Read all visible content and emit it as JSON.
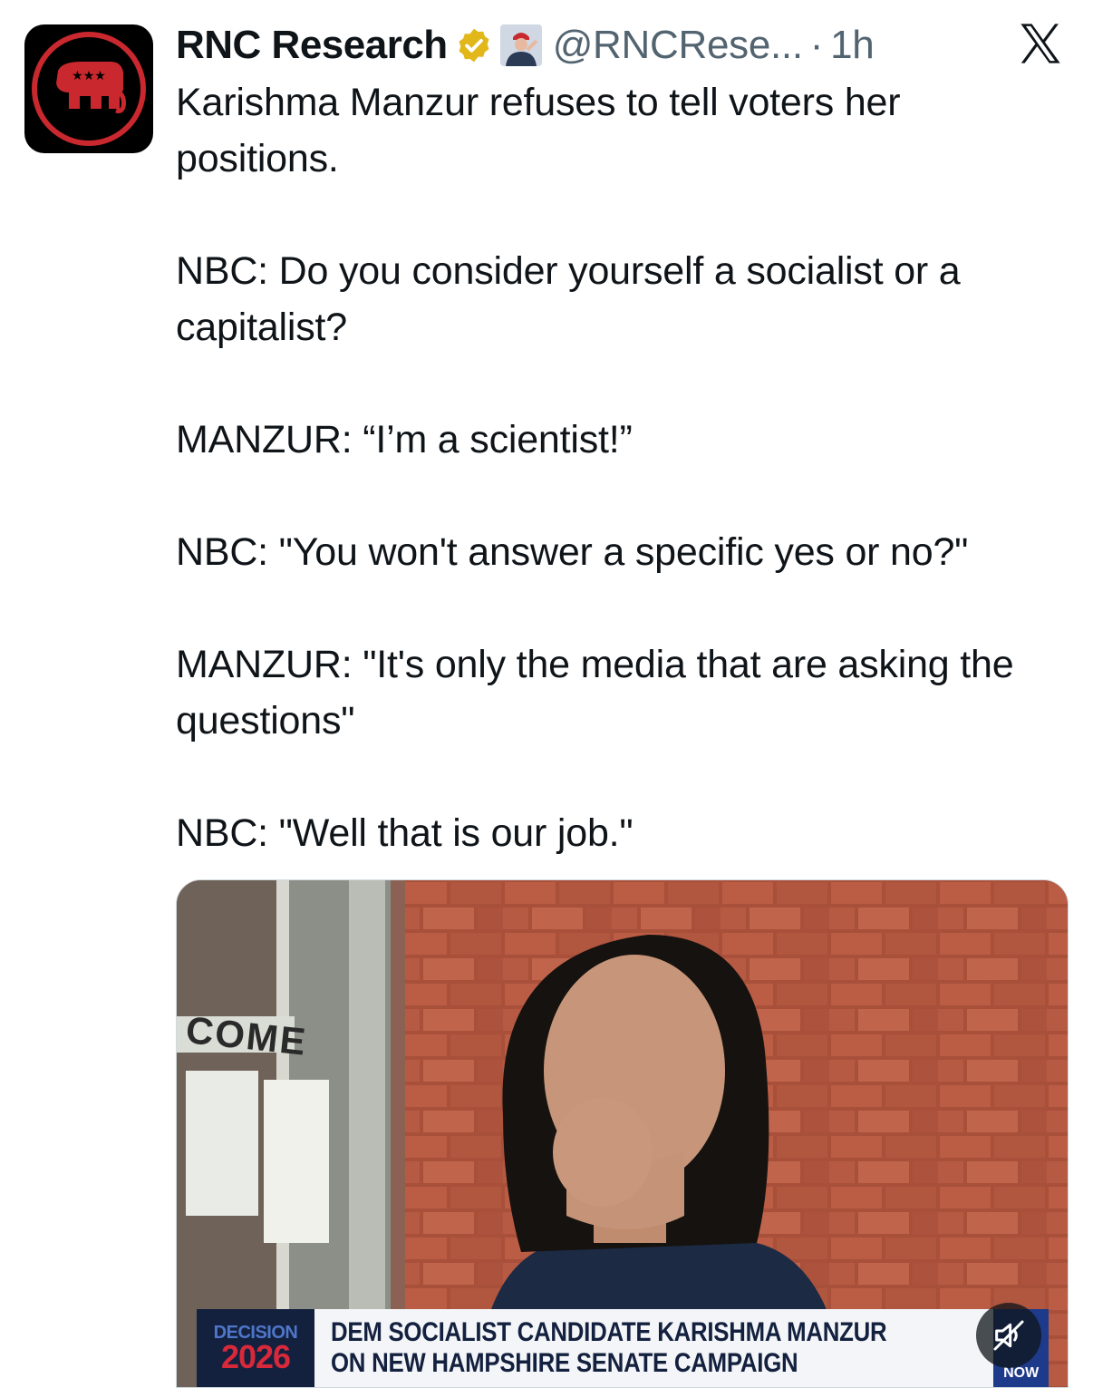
{
  "account": {
    "name": "RNC Research",
    "handle": "@RNCRese...",
    "separator": "·",
    "timestamp": "1h",
    "verified": true
  },
  "tweet": {
    "paragraphs": [
      "Karishma Manzur refuses to tell voters her positions.",
      "NBC: Do you consider yourself a socialist or a capitalist?",
      "MANZUR: “I’m a scientist!”",
      "NBC: \"You won't answer a specific yes or no?\"",
      "MANZUR: \"It's only the media that are asking the questions\"",
      "NBC: \"Well that is our job.\""
    ]
  },
  "media": {
    "sign_text": "COME",
    "lower_third": {
      "logo_top": "DECISION",
      "logo_year": "2026",
      "line1": "DEM SOCIALIST CANDIDATE KARISHMA MANZUR",
      "line2": "ON NEW HAMPSHIRE SENATE CAMPAIGN",
      "brand": "NOW"
    }
  },
  "icons": {
    "avatar": "rnc-elephant-logo",
    "badge": "verified-gold-badge-icon",
    "affiliate": "affiliate-avatar",
    "platform": "x-logo-icon",
    "mute": "mute-icon"
  },
  "colors": {
    "text": "#0f1419",
    "muted": "#536471",
    "rnc_red": "#c8282e",
    "badge_gold": "#e2b719",
    "brick": "#b3553f",
    "lower_third_navy": "#13213f"
  }
}
